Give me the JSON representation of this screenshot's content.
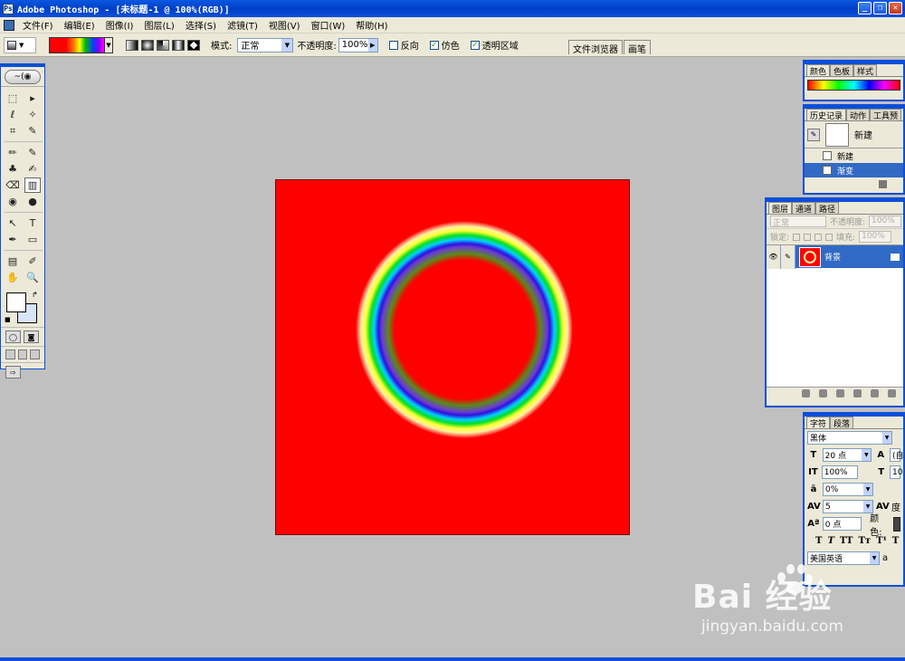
{
  "window": {
    "title": "Adobe Photoshop - [未标题-1 @ 100%(RGB)]",
    "buttons": {
      "minimize": "_",
      "restore": "❐",
      "close": "✕"
    }
  },
  "menu": {
    "items": [
      "文件(F)",
      "编辑(E)",
      "图像(I)",
      "图层(L)",
      "选择(S)",
      "滤镜(T)",
      "视图(V)",
      "窗口(W)",
      "帮助(H)"
    ]
  },
  "options": {
    "mode_label": "模式:",
    "mode_value": "正常",
    "opacity_label": "不透明度:",
    "opacity_value": "100%",
    "reverse_label": "反向",
    "reverse_checked": false,
    "dither_label": "仿色",
    "dither_checked": true,
    "transparency_label": "透明区域",
    "transparency_checked": true,
    "check_mark": "✓"
  },
  "palette_well": {
    "tabs": [
      "文件浏览器",
      "画笔"
    ]
  },
  "toolbox": {
    "logo": "~(◉",
    "tools": [
      "⬚",
      "▸",
      "ℓ",
      "✧",
      "⌗",
      "✎",
      "✏",
      "✎",
      "♣",
      "✍",
      "⌫",
      "▥",
      "◉",
      "●",
      "↖",
      "T",
      "✒",
      "▭",
      "▤",
      "✐",
      "✋",
      "🔍"
    ]
  },
  "colors": {
    "accent": "#0a4fd8",
    "canvas_fill": "#ff0000",
    "foreground": "#ffffff",
    "background": "#d8e4f8",
    "selection": "#316ac5"
  },
  "panels": {
    "color": {
      "tabs": [
        "颜色",
        "色板",
        "样式"
      ]
    },
    "history": {
      "tabs": [
        "历史记录",
        "动作",
        "工具预"
      ],
      "snapshot": "新建",
      "states": [
        {
          "label": "新建",
          "selected": false
        },
        {
          "label": "渐变",
          "selected": true
        }
      ]
    },
    "layers": {
      "tabs": [
        "图层",
        "通道",
        "路径"
      ],
      "blend_mode": "正常",
      "opacity_label": "不透明度:",
      "opacity_value": "100%",
      "lock_label": "锁定:",
      "fill_label": "填充:",
      "fill_value": "100%",
      "layer_name": "背景"
    },
    "character": {
      "tabs": [
        "字符",
        "段落"
      ],
      "font": "黑体",
      "size": "20 点",
      "leading": "(自",
      "vscale": "100%",
      "hscale": "10",
      "tsume": "0%",
      "tracking": "5",
      "tracking_label": "度",
      "baseline": "0 点",
      "color_label": "颜色:",
      "language": "美国英语",
      "aa": "a",
      "style_buttons": [
        "T",
        "T",
        "TT",
        "Tт",
        "T¹",
        "T"
      ]
    }
  },
  "watermark": {
    "logo": "Bai  经验",
    "url": "jingyan.baidu.com"
  }
}
